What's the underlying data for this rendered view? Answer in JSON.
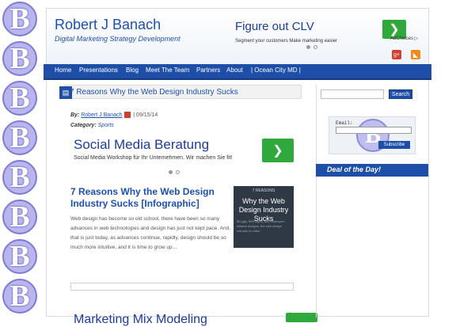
{
  "site": {
    "title": "Robert J Banach",
    "tagline": "Digital Marketing Strategy Development",
    "badge_letter": "B"
  },
  "top_ad": {
    "title": "Figure out CLV",
    "subtitle": "Segment your customers Make marketing easier",
    "adchoices": "AdChoices ▷",
    "arrow": "❯"
  },
  "social": {
    "gplus": "g+",
    "rss": "◣"
  },
  "nav": {
    "items": [
      "Home",
      "Presentations",
      "Blog",
      "Meet The Team",
      "Partners",
      "About",
      "| Ocean City MD |"
    ]
  },
  "post": {
    "bar_title": "7 Reasons Why the Web Design Industry Sucks",
    "by_label": "By:",
    "author": "Robert J Banach",
    "date": "| 09/15/14",
    "category_label": "Category:",
    "category": "Sports",
    "article_title": "7 Reasons Why the Web Design Industry Sucks [Infographic]",
    "excerpt": "Web design has become so old school, there have been so many advances in web technologies and design has just not kept pace. And, that is just today, as advances continue, rapidly, design should be so much more intuitive, and it is time to grow up…",
    "thumb_small": "7 REASONS",
    "thumb_big": "Why the Web Design Industry Sucks",
    "thumb_body": "$5 gigs, $99 logos, and employee-inflated designs, the web design industry is rotten."
  },
  "mid_ad": {
    "title": "Social Media Beratung",
    "subtitle": "Social Media Workshop für Ihr Unternehmen. Wir machen Sie fit!",
    "arrow": "❯"
  },
  "bottom_ad": {
    "title": "Marketing Mix Modeling"
  },
  "sidebar": {
    "search_button": "Search",
    "email_label": "Email:",
    "subscribe": "Subscribe",
    "deal": "Deal of the Day!"
  },
  "colors": {
    "brand_blue": "#1e4fa8",
    "link_blue": "#1e50b3",
    "ad_green": "#2fa93c",
    "badge_purple": "#b9b6ee"
  }
}
